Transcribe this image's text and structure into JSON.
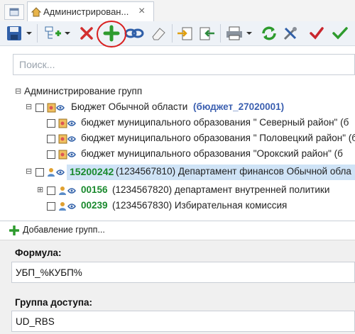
{
  "tab": {
    "title": "Администрирован...",
    "close": "×"
  },
  "toolbar": {
    "icons": [
      "save-icon",
      "tree-add-icon",
      "delete-icon",
      "add-icon",
      "link-icon",
      "eraser-icon",
      "export-icon",
      "import-icon",
      "print-icon",
      "refresh-icon",
      "settings-icon",
      "check-icon",
      "check-all-icon"
    ],
    "highlight_color": "#d92020"
  },
  "search": {
    "placeholder": "Поиск..."
  },
  "tree": {
    "root": "Администрирование групп",
    "budget": {
      "label": "Бюджет Обычной области",
      "code": "(бюджет_27020001)"
    },
    "children": [
      {
        "text": "бюджет муниципального образования \" Северный  район\" (б"
      },
      {
        "text": "бюджет муниципального образования \" Половецкий район\" (б"
      },
      {
        "text": "бюджет муниципального образования \"Орокский  район\" (б"
      }
    ],
    "departments": [
      {
        "code": "15200242",
        "rest": " (1234567810) Департамент финансов Обычной обла"
      },
      {
        "code": "00156",
        "rest": " (1234567820) департамент внутренней политики"
      },
      {
        "code": "00239",
        "rest": " (1234567830) Избирательная комиссия"
      }
    ]
  },
  "dialog": {
    "title": "Добавление групп...",
    "formula_label": "Формула:",
    "formula_value": "УБП_%КУБП%",
    "group_label": "Группа доступа:",
    "group_value": "UD_RBS"
  }
}
